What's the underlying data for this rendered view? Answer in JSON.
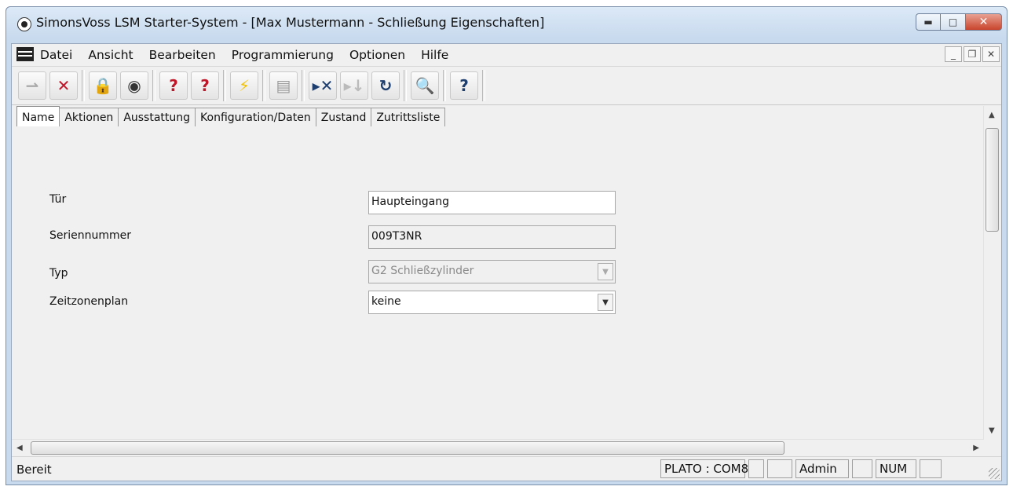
{
  "window": {
    "title": "SimonsVoss LSM Starter-System - [Max Mustermann - Schließung Eigenschaften]"
  },
  "menu": {
    "items": [
      "Datei",
      "Ansicht",
      "Bearbeiten",
      "Programmierung",
      "Optionen",
      "Hilfe"
    ]
  },
  "toolbar": {
    "buttons": [
      "arrow-icon",
      "cancel-transfer-icon",
      "add-lock-icon",
      "add-transponder-icon",
      "lock-question-icon",
      "transponder-question-icon",
      "lightning-icon",
      "printer-icon",
      "skip-x-icon",
      "step-down-icon",
      "refresh-icon",
      "search-icon",
      "help-icon"
    ]
  },
  "tabs": [
    "Name",
    "Aktionen",
    "Ausstattung",
    "Konfiguration/Daten",
    "Zustand",
    "Zutrittsliste"
  ],
  "form": {
    "tuer_label": "Tür",
    "tuer_value": "Haupteingang",
    "serial_label": "Seriennummer",
    "serial_value": "009T3NR",
    "typ_label": "Typ",
    "typ_value": "G2 Schließzylinder",
    "zeitzone_label": "Zeitzonenplan",
    "zeitzone_value": "keine"
  },
  "statusbar": {
    "text": "Bereit",
    "port": "PLATO : COM8",
    "user": "Admin",
    "num": "NUM"
  }
}
